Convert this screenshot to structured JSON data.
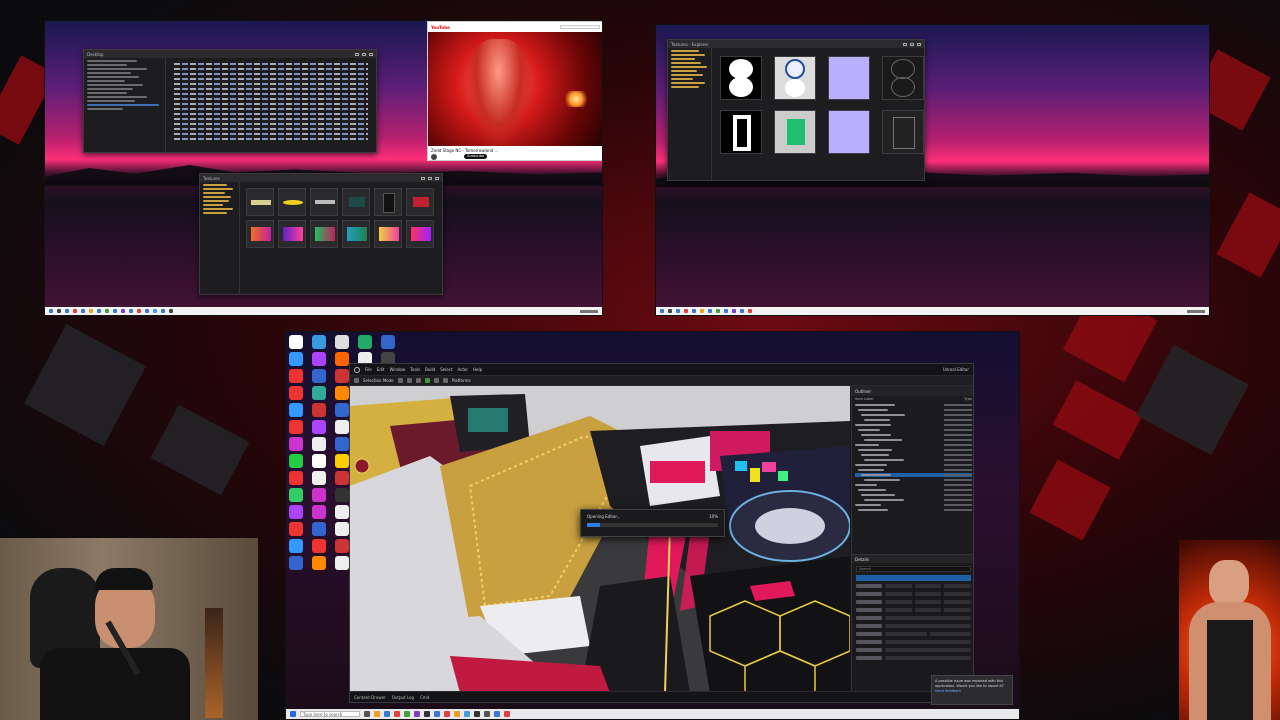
{
  "screen": {
    "width": 1280,
    "height": 720
  },
  "colors": {
    "accent_red": "#8a0a12",
    "wallpaper_pink": "#ff2f7a",
    "ue_selection": "#1f5fa8",
    "progress_fill": "#2f7de0"
  },
  "monitor_top_left": {
    "explorer_window": {
      "title": "Desktop"
    },
    "video_window": {
      "channel_logo": "YouTube",
      "video_title": "Zedd Stage NC - Tomorrowland ...",
      "subscribe_label": "Subscribe"
    },
    "asset_browser": {
      "title": "Textures"
    },
    "taskbar_icons": 16
  },
  "monitor_top_right": {
    "texture_window": {
      "title": "Textures - Explorer"
    }
  },
  "main_screen": {
    "desktop_icon_rows": 16,
    "unreal": {
      "window_title": "Unreal Editor",
      "menu": [
        "File",
        "Edit",
        "Window",
        "Tools",
        "Build",
        "Select",
        "Actor",
        "Help"
      ],
      "toolbar": {
        "mode": "Selection Mode",
        "platforms": "Platforms"
      },
      "outliner": {
        "title": "Outliner",
        "column_item": "Item Label",
        "column_type": "Type"
      },
      "details": {
        "title": "Details",
        "search_placeholder": "Search"
      },
      "bottom_bar": [
        "Content Drawer",
        "Output Log",
        "Cmd"
      ],
      "progress_dialog": {
        "label": "Opening Editor...",
        "percent": "10%",
        "fill_fraction": 0.1
      }
    },
    "notification": {
      "text": "A possible issue was reported with this application. Would you like to report it?",
      "button": "Send feedback"
    },
    "taskbar": {
      "search_placeholder": "Type here to search"
    }
  },
  "webcam_left": {
    "subject": "streamer"
  },
  "webcam_right": {
    "subject": "overlay-character"
  }
}
